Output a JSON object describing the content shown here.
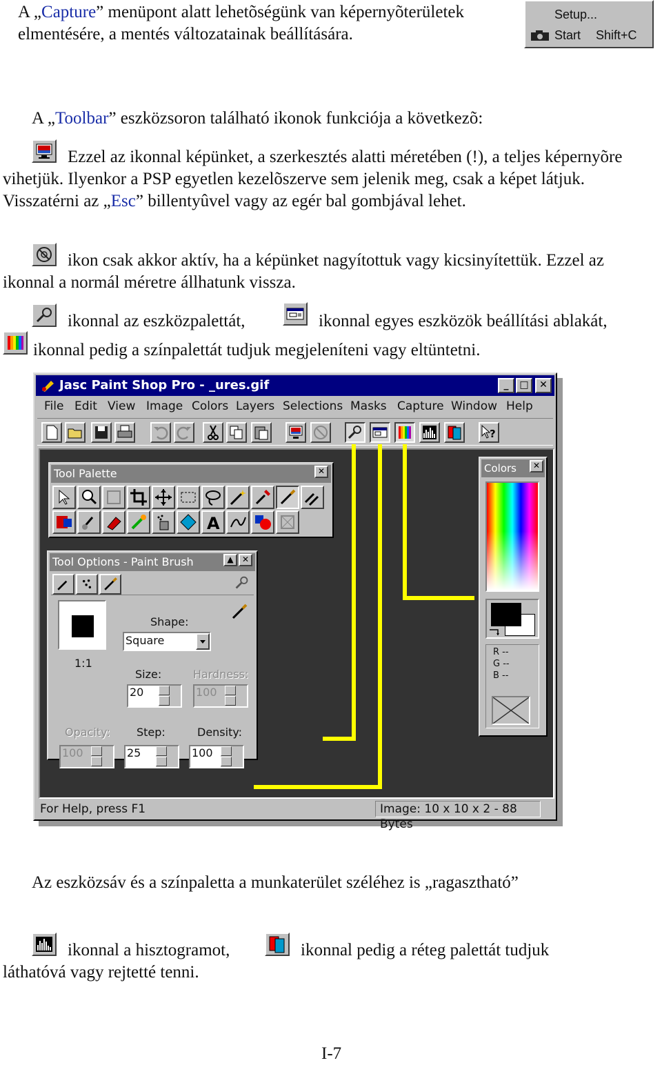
{
  "intro": {
    "p1_pre": "A „",
    "p1_link": "Capture",
    "p1_post": "” menüpont alatt lehetõségünk van képernyõterületek elmentésére, a mentés változatainak beállítására.",
    "p2_pre": "A „",
    "p2_link": "Toolbar",
    "p2_post": "” eszközsoron található ikonok funkciója a következõ:"
  },
  "capture_menu": {
    "setup": "Setup...",
    "start": "Start",
    "shortcut": "Shift+C"
  },
  "body": {
    "p3": "Ezzel az ikonnal képünket, a szerkesztés alatti méretében (!), a teljes képernyõre vihetjük. Ilyenkor a PSP egyetlen kezelõszerve sem jelenik meg, csak a képet látjuk. Visszatérni az „",
    "p3_key": "Esc",
    "p3_post": "” billentyûvel vagy az egér bal gombjával lehet.",
    "p4": "ikon csak akkor aktív, ha a képünket nagyítottuk vagy kicsinyítettük. Ezzel az ikonnal a normál méretre állhatunk vissza.",
    "p5a": "ikonnal az eszközpalettát,",
    "p5b": "ikonnal egyes eszközök beállítási ablakát,",
    "p5c": "ikonnal pedig a színpalettát tudjuk megjeleníteni vagy eltüntetni.",
    "p6": "Az eszközsáv és a színpaletta a munkaterület széléhez is „ragasztható”",
    "p7a": "ikonnal a hisztogramot,",
    "p7b": "ikonnal pedig a réteg palettát tudjuk láthatóvá vagy rejtetté tenni."
  },
  "psp_window": {
    "title": "Jasc Paint Shop Pro - _ures.gif",
    "menu": [
      "File",
      "Edit",
      "View",
      "Image",
      "Colors",
      "Layers",
      "Selections",
      "Masks",
      "Capture",
      "Window",
      "Help"
    ],
    "status_left": "For Help, press F1",
    "status_right": "Image:  10 x 10 x 2 - 88 Bytes",
    "tool_palette": {
      "title": "Tool Palette"
    },
    "colors_panel": {
      "title": "Colors",
      "r": "R --",
      "g": "G --",
      "b": "B --"
    },
    "tool_options": {
      "title": "Tool Options - Paint Brush",
      "ratio": "1:1",
      "shape_label": "Shape:",
      "shape_value": "Square",
      "size_label": "Size:",
      "size_value": "20",
      "hardness_label": "Hardness:",
      "hardness_value": "100",
      "opacity_label": "Opacity:",
      "opacity_value": "100",
      "step_label": "Step:",
      "step_value": "25",
      "density_label": "Density:",
      "density_value": "100"
    }
  },
  "page_number": "I-7",
  "colors": {
    "link": "#1a2ea8",
    "title_active": "#000080",
    "callout": "#ffff00",
    "workspace": "#333333"
  }
}
